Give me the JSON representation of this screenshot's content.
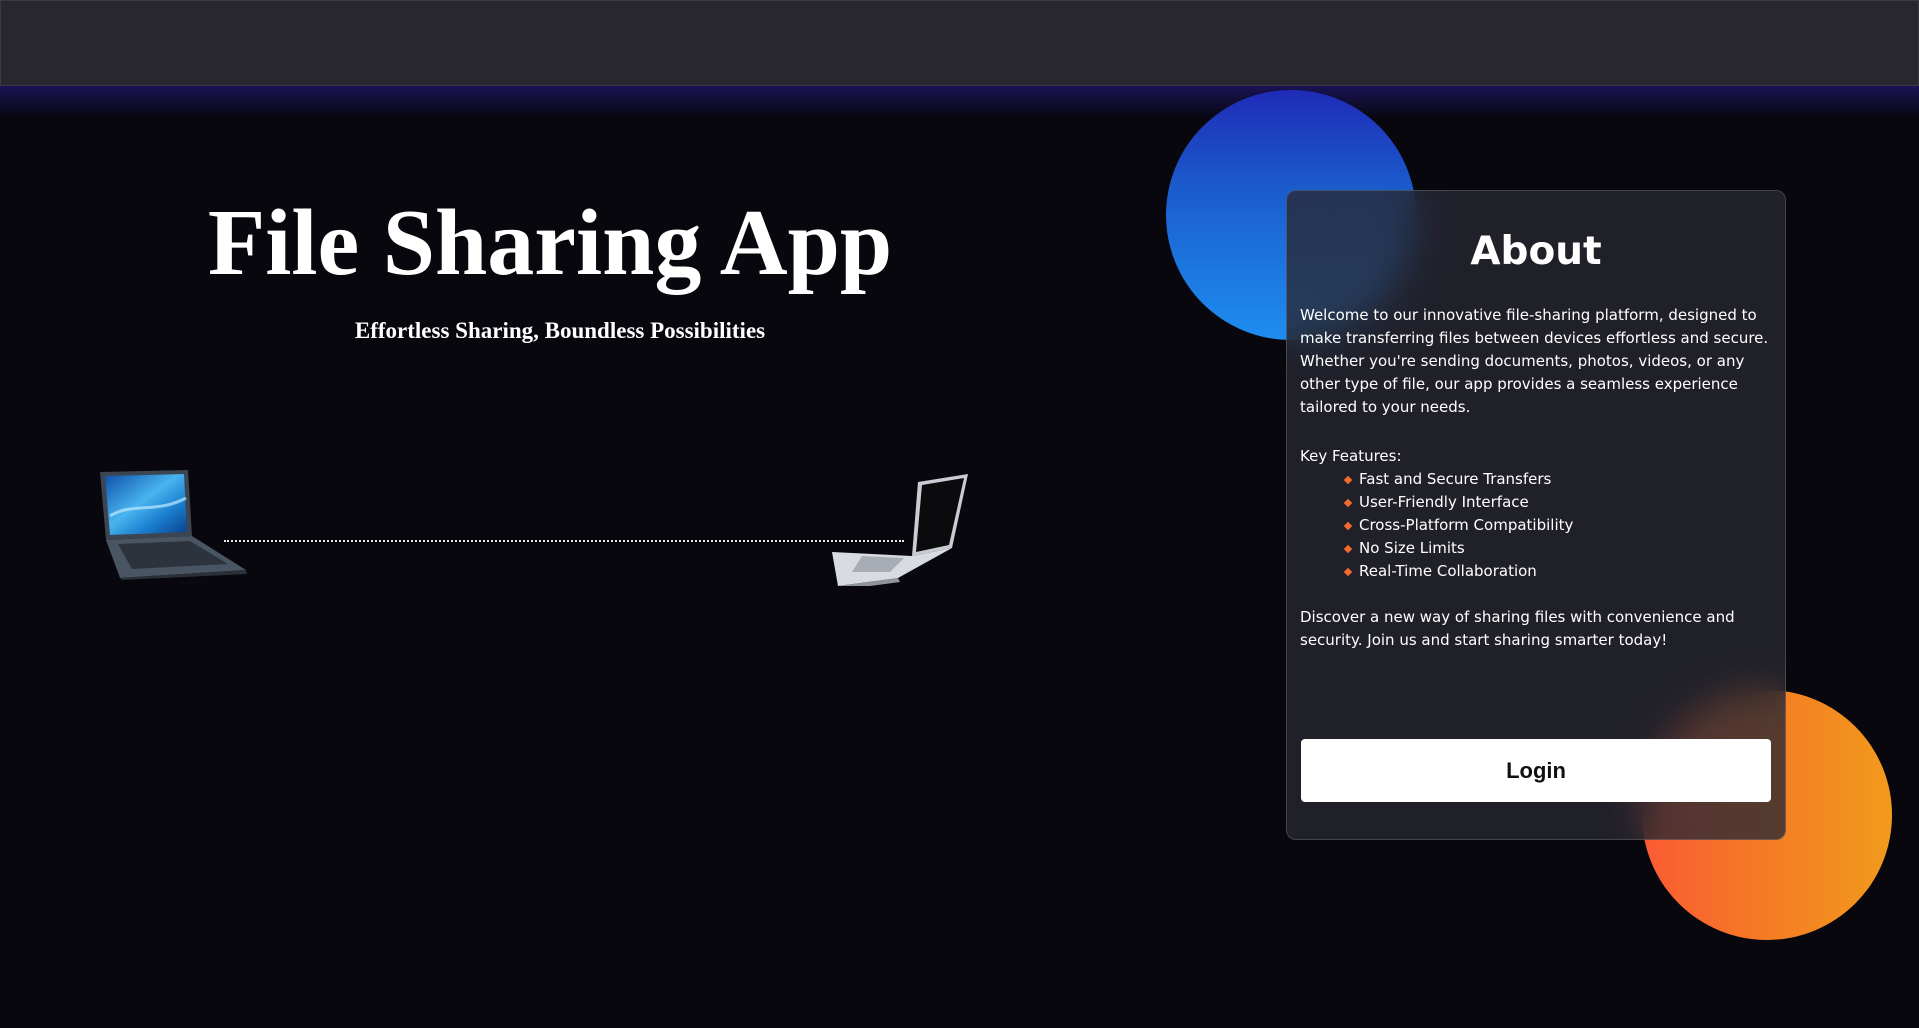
{
  "hero": {
    "title": "File Sharing App",
    "subtitle": "Effortless Sharing, Boundless Possibilities"
  },
  "illustration": {
    "left_device": "laptop-icon",
    "right_device": "laptop-icon",
    "connector": "dotted-line"
  },
  "about": {
    "title": "About",
    "intro": "Welcome to our innovative file-sharing platform, designed to make transferring files between devices effortless and secure. Whether you're sending documents, photos, videos, or any other type of file, our app provides a seamless experience tailored to your needs.",
    "features_label": "Key Features:",
    "features": [
      "Fast and Secure Transfers",
      "User-Friendly Interface",
      "Cross-Platform Compatibility",
      "No Size Limits",
      "Real-Time Collaboration"
    ],
    "outro": "Discover a new way of sharing files with convenience and security. Join us and start sharing smarter today!",
    "login_label": "Login"
  },
  "colors": {
    "background": "#07070d",
    "topbar": "#28272f",
    "card": "#28282f",
    "accent_blue": "#1e8ef0",
    "accent_orange": "#f47c24",
    "bullet": "#f26a2c",
    "button": "#ffffff"
  }
}
